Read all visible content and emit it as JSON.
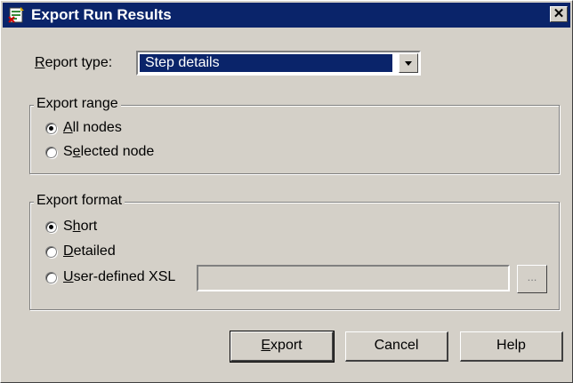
{
  "window": {
    "title": "Export Run Results",
    "close_glyph": "✕"
  },
  "report_type": {
    "label_mnemonic": "R",
    "label_rest": "eport type:",
    "value": "Step details"
  },
  "export_range": {
    "legend": "Export range",
    "options": [
      {
        "mnemonic": "A",
        "rest": "ll nodes",
        "pre": "",
        "checked": true
      },
      {
        "pre": "S",
        "mnemonic": "e",
        "rest": "lected node",
        "checked": false
      }
    ]
  },
  "export_format": {
    "legend": "Export format",
    "options": [
      {
        "pre": "S",
        "mnemonic": "h",
        "rest": "ort",
        "checked": true
      },
      {
        "pre": "",
        "mnemonic": "D",
        "rest": "etailed",
        "checked": false
      },
      {
        "pre": "",
        "mnemonic": "U",
        "rest": "ser-defined XSL",
        "checked": false
      }
    ],
    "xsl_value": "",
    "browse_label": "..."
  },
  "buttons": {
    "export_mnemonic": "E",
    "export_rest": "xport",
    "cancel": "Cancel",
    "help": "Help"
  }
}
